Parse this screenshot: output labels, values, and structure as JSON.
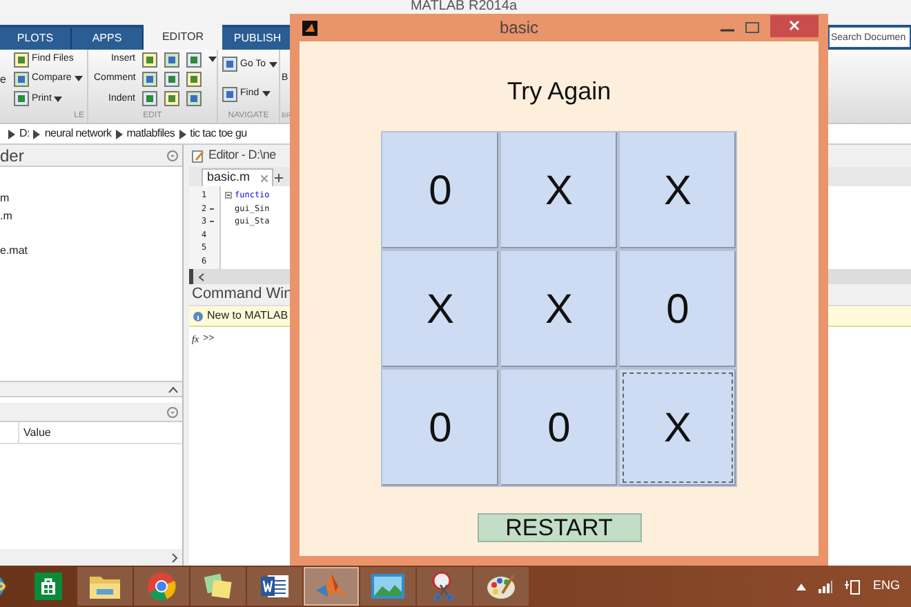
{
  "matlab": {
    "title": "MATLAB R2014a",
    "ribbon_tabs": [
      {
        "label": "PLOTS",
        "selected": false
      },
      {
        "label": "APPS",
        "selected": false
      },
      {
        "label": "EDITOR",
        "selected": true
      },
      {
        "label": "PUBLISH",
        "selected": false
      }
    ],
    "search": {
      "placeholder": "Search Documen"
    },
    "ribbon_groups": [
      {
        "label": "LE",
        "big_button": "e",
        "buttons": [
          {
            "label": "Find Files",
            "dropdown": false
          },
          {
            "label": "Compare",
            "dropdown": true
          },
          {
            "label": "Print",
            "dropdown": true
          }
        ]
      },
      {
        "label": "EDIT",
        "buttons": [
          {
            "label": "Insert",
            "dropdown": true
          },
          {
            "label": "Comment",
            "dropdown": false
          },
          {
            "label": "Indent",
            "dropdown": false
          }
        ]
      },
      {
        "label": "NAVIGATE",
        "buttons": [
          {
            "label": "Go To",
            "dropdown": true
          },
          {
            "label": "Find",
            "dropdown": true
          }
        ]
      },
      {
        "label": "BR",
        "big_button": "B"
      }
    ],
    "path": [
      "D:",
      "neural network",
      "matlabfiles",
      "tic tac toe gu"
    ],
    "current_folder": {
      "title": "der",
      "files": [
        {
          "name": "m"
        },
        {
          "name": ".m"
        },
        {
          "name": "e.mat"
        }
      ]
    },
    "workspace": {
      "columns": [
        "Value"
      ]
    },
    "editor": {
      "title": "Editor - D:\\ne",
      "tabs": [
        {
          "label": "basic.m",
          "selected": true
        }
      ],
      "lines": [
        {
          "number": "1",
          "dash": false,
          "code": "functio",
          "keyword": true
        },
        {
          "number": "2",
          "dash": true,
          "code": "gui_Sin",
          "keyword": false
        },
        {
          "number": "3",
          "dash": true,
          "code": "gui_Sta",
          "keyword": false
        },
        {
          "number": "4",
          "dash": false
        },
        {
          "number": "5",
          "dash": false
        },
        {
          "number": "6",
          "dash": false
        }
      ]
    },
    "command_window": {
      "title": "Command Win",
      "notice": "New to MATLAB",
      "fx_icon": "fx",
      "prompt": ">>"
    }
  },
  "figure": {
    "title": "basic",
    "message": "Try Again",
    "cells": [
      {
        "mark": "0",
        "focused": false
      },
      {
        "mark": "X",
        "focused": false
      },
      {
        "mark": "X",
        "focused": false
      },
      {
        "mark": "X",
        "focused": false
      },
      {
        "mark": "X",
        "focused": false
      },
      {
        "mark": "0",
        "focused": false
      },
      {
        "mark": "0",
        "focused": false
      },
      {
        "mark": "0",
        "focused": false
      },
      {
        "mark": "X",
        "focused": true
      }
    ],
    "restart": "RESTART"
  },
  "taskbar": {
    "apps": [
      {
        "kind": "browser",
        "running": false,
        "active": false
      },
      {
        "kind": "store",
        "running": false,
        "active": false
      },
      {
        "kind": "folder",
        "running": true,
        "active": false
      },
      {
        "kind": "chrome",
        "running": true,
        "active": false
      },
      {
        "kind": "notes",
        "running": true,
        "active": false
      },
      {
        "kind": "word",
        "running": true,
        "active": false
      },
      {
        "kind": "matlab",
        "running": true,
        "active": true
      },
      {
        "kind": "photos",
        "running": true,
        "active": false
      },
      {
        "kind": "scissors",
        "running": true,
        "active": false
      },
      {
        "kind": "palette",
        "running": true,
        "active": false
      }
    ],
    "language": "ENG"
  }
}
